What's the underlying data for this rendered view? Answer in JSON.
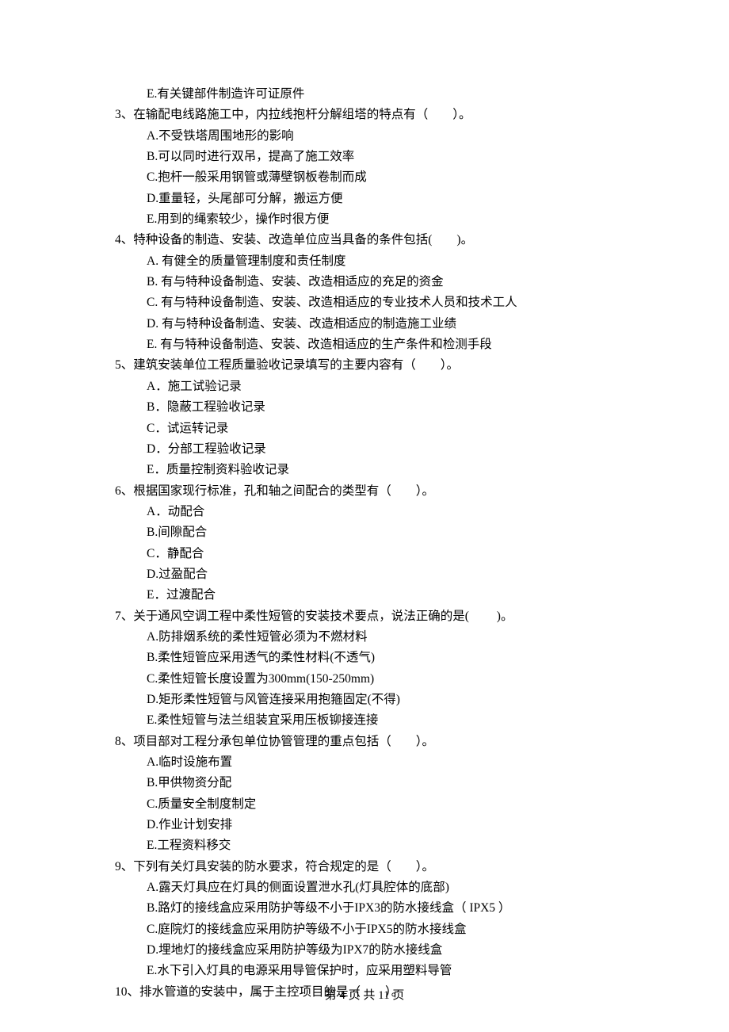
{
  "lines": [
    {
      "cls": "option",
      "text": "E.有关键部件制造许可证原件"
    },
    {
      "cls": "question",
      "text": "3、在输配电线路施工中，内拉线抱杆分解组塔的特点有（　　）。"
    },
    {
      "cls": "option",
      "text": "A.不受铁塔周围地形的影响"
    },
    {
      "cls": "option",
      "text": "B.可以同时进行双吊，提高了施工效率"
    },
    {
      "cls": "option",
      "text": "C.抱杆一般采用钢管或薄壁钢板卷制而成"
    },
    {
      "cls": "option",
      "text": "D.重量轻，头尾部可分解，搬运方便"
    },
    {
      "cls": "option",
      "text": "E.用到的绳索较少，操作时很方便"
    },
    {
      "cls": "question",
      "text": "4、特种设备的制造、安装、改造单位应当具备的条件包括(　　)。"
    },
    {
      "cls": "option",
      "text": "A. 有健全的质量管理制度和责任制度"
    },
    {
      "cls": "option",
      "text": "B. 有与特种设备制造、安装、改造相适应的充足的资金"
    },
    {
      "cls": "option",
      "text": "C. 有与特种设备制造、安装、改造相适应的专业技术人员和技术工人"
    },
    {
      "cls": "option",
      "text": "D. 有与特种设备制造、安装、改造相适应的制造施工业绩"
    },
    {
      "cls": "option",
      "text": "E. 有与特种设备制造、安装、改造相适应的生产条件和检测手段"
    },
    {
      "cls": "question",
      "text": "5、建筑安装单位工程质量验收记录填写的主要内容有（　　）。"
    },
    {
      "cls": "option",
      "text": "A．施工试验记录"
    },
    {
      "cls": "option",
      "text": "B．隐蔽工程验收记录"
    },
    {
      "cls": "option",
      "text": "C．试运转记录"
    },
    {
      "cls": "option",
      "text": "D．分部工程验收记录"
    },
    {
      "cls": "option",
      "text": "E．质量控制资料验收记录"
    },
    {
      "cls": "question",
      "text": "6、根据国家现行标准，孔和轴之间配合的类型有（　　）。"
    },
    {
      "cls": "option",
      "text": "A．动配合"
    },
    {
      "cls": "option",
      "text": "B.间隙配合"
    },
    {
      "cls": "option",
      "text": "C．静配合"
    },
    {
      "cls": "option",
      "text": "D.过盈配合"
    },
    {
      "cls": "option",
      "text": "E．过渡配合"
    },
    {
      "cls": "question",
      "text": "7、关于通风空调工程中柔性短管的安装技术要点，说法正确的是(　　 )。"
    },
    {
      "cls": "option",
      "text": "A.防排烟系统的柔性短管必须为不燃材料"
    },
    {
      "cls": "option",
      "text": "B.柔性短管应采用透气的柔性材料(不透气)"
    },
    {
      "cls": "option",
      "text": "C.柔性短管长度设置为300mm(150-250mm)"
    },
    {
      "cls": "option",
      "text": "D.矩形柔性短管与风管连接采用抱箍固定(不得)"
    },
    {
      "cls": "option",
      "text": "E.柔性短管与法兰组装宜采用压板铆接连接"
    },
    {
      "cls": "question",
      "text": "8、项目部对工程分承包单位协管管理的重点包括（　　）。"
    },
    {
      "cls": "option",
      "text": "A.临时设施布置"
    },
    {
      "cls": "option",
      "text": "B.甲供物资分配"
    },
    {
      "cls": "option",
      "text": "C.质量安全制度制定"
    },
    {
      "cls": "option",
      "text": "D.作业计划安排"
    },
    {
      "cls": "option",
      "text": "E.工程资料移交"
    },
    {
      "cls": "question",
      "text": "9、下列有关灯具安装的防水要求，符合规定的是（　　）。"
    },
    {
      "cls": "option",
      "text": "A.露天灯具应在灯具的侧面设置泄水孔(灯具腔体的底部)"
    },
    {
      "cls": "option",
      "text": "B.路灯的接线盒应采用防护等级不小于IPX3的防水接线盒（ IPX5 ）"
    },
    {
      "cls": "option",
      "text": "C.庭院灯的接线盒应采用防护等级不小于IPX5的防水接线盒"
    },
    {
      "cls": "option",
      "text": "D.埋地灯的接线盒应采用防护等级为IPX7的防水接线盒"
    },
    {
      "cls": "option",
      "text": "E.水下引入灯具的电源采用导管保护时，应采用塑料导管"
    },
    {
      "cls": "question",
      "text": "10、排水管道的安装中，属于主控项目的是（　　）。"
    }
  ],
  "footer": "第 4 页 共 11 页"
}
